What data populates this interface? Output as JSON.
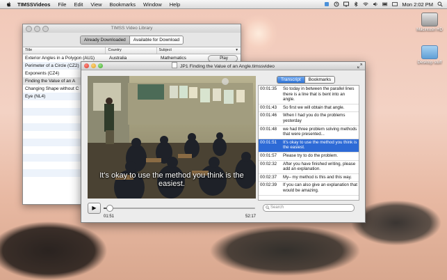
{
  "menubar": {
    "app": "TIMSSVideos",
    "items": [
      "File",
      "Edit",
      "View",
      "Bookmarks",
      "Window",
      "Help"
    ],
    "clock": "Mon 2:02 PM"
  },
  "desktop": {
    "icons": [
      "Macintosh HD",
      "Desktop stuff"
    ]
  },
  "library": {
    "title": "TIMSS Video Library",
    "segments": [
      "Already Downloaded",
      "Available for Download"
    ],
    "columns": [
      "Title",
      "Country",
      "Subject"
    ],
    "rows": [
      {
        "title": "Exterior Angles in a Polygon (AU1)",
        "country": "Australia",
        "subject": "Mathematics",
        "action": "Play"
      },
      {
        "title": "Perimeter of a Circle (CZ2)",
        "country": "",
        "subject": "",
        "action": ""
      },
      {
        "title": "Exponents (CZ4)",
        "country": "",
        "subject": "",
        "action": ""
      },
      {
        "title": "Finding the Value of an A",
        "country": "",
        "subject": "",
        "action": ""
      },
      {
        "title": "Changing Shape without C",
        "country": "",
        "subject": "",
        "action": ""
      },
      {
        "title": "Eye (NL4)",
        "country": "",
        "subject": "",
        "action": ""
      }
    ]
  },
  "player": {
    "title": "JP1 Finding the Value of an Angle.timssvideo",
    "subtitle": "It's okay to use the method you think is the easiest.",
    "time_elapsed": "01:51",
    "time_total": "52:17",
    "progress": 0.035,
    "tabs": [
      "Transcript",
      "Bookmarks"
    ],
    "search_placeholder": "Search",
    "transcript": [
      {
        "t": "00:01:35",
        "text": "So today in between the parallel lines there is a line that is bent into an angle."
      },
      {
        "t": "00:01:43",
        "text": "So first we will obtain that angle."
      },
      {
        "t": "00:01:46",
        "text": "When I had you do the problems yesterday"
      },
      {
        "t": "00:01:48",
        "text": "we had three problem solving methods that were presented..."
      },
      {
        "t": "00:01:51",
        "text": "It's okay to use the method you think is the easiest."
      },
      {
        "t": "00:01:57",
        "text": "Please try to do the problem."
      },
      {
        "t": "00:02:32",
        "text": "After you have finished writing, please add an explanation."
      },
      {
        "t": "00:02:37",
        "text": "My– my method is this and this way."
      },
      {
        "t": "00:02:39",
        "text": "If you can also give an explanation that would be amazing."
      }
    ],
    "selected_index": 4
  }
}
